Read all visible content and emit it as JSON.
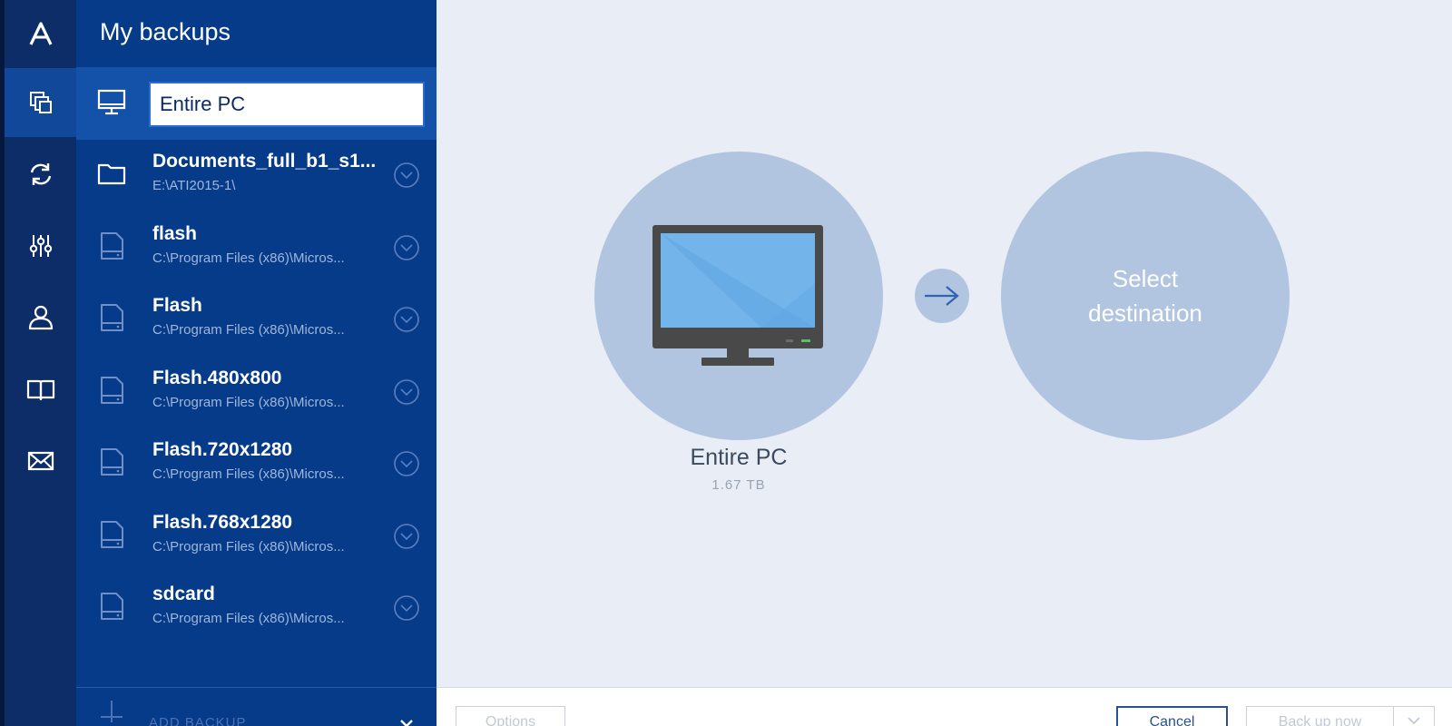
{
  "sidebar": {
    "title": "My backups",
    "selected": {
      "name_value": "Entire PC",
      "icon": "monitor-icon"
    },
    "items": [
      {
        "name": "Documents_full_b1_s1...",
        "path": "E:\\ATI2015-1\\",
        "icon": "folder-icon"
      },
      {
        "name": "flash",
        "path": "C:\\Program Files (x86)\\Micros...",
        "icon": "file-icon"
      },
      {
        "name": "Flash",
        "path": "C:\\Program Files (x86)\\Micros...",
        "icon": "file-icon"
      },
      {
        "name": "Flash.480x800",
        "path": "C:\\Program Files (x86)\\Micros...",
        "icon": "file-icon"
      },
      {
        "name": "Flash.720x1280",
        "path": "C:\\Program Files (x86)\\Micros...",
        "icon": "file-icon"
      },
      {
        "name": "Flash.768x1280",
        "path": "C:\\Program Files (x86)\\Micros...",
        "icon": "file-icon"
      },
      {
        "name": "sdcard",
        "path": "C:\\Program Files (x86)\\Micros...",
        "icon": "file-icon"
      }
    ],
    "add_backup_label": "ADD BACKUP"
  },
  "rail": {
    "items": [
      "acronis-logo-icon",
      "backup-icon",
      "sync-icon",
      "tools-icon",
      "account-icon",
      "help-book-icon",
      "mail-icon"
    ],
    "active": "backup-icon"
  },
  "main": {
    "source": {
      "name": "Entire PC",
      "size": "1.67 TB"
    },
    "destination": {
      "label": "Select destination"
    }
  },
  "footer": {
    "options_label": "Options",
    "cancel_label": "Cancel",
    "backup_now_label": "Back up now"
  },
  "colors": {
    "rail": "#0c2d68",
    "panel": "#063b8a",
    "selected_row": "#1352a8",
    "circle": "#b2c5e0",
    "main_bg": "#e9edf5"
  }
}
